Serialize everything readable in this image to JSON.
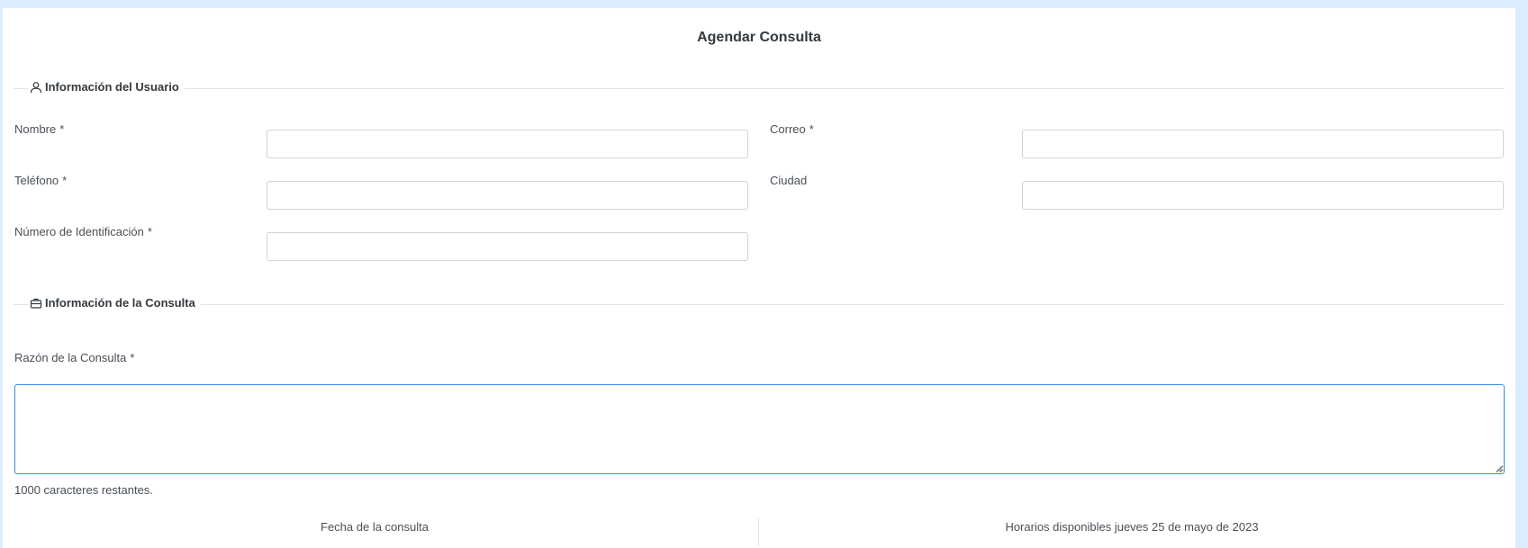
{
  "form": {
    "title": "Agendar Consulta",
    "required_mark": "*"
  },
  "user_section": {
    "legend": "Información del Usuario",
    "icon": "user-icon",
    "fields": {
      "nombre": {
        "label": "Nombre",
        "required": true,
        "value": ""
      },
      "correo": {
        "label": "Correo",
        "required": true,
        "value": ""
      },
      "telefono": {
        "label": "Teléfono",
        "required": true,
        "value": ""
      },
      "ciudad": {
        "label": "Ciudad",
        "required": false,
        "value": ""
      },
      "identificacion": {
        "label": "Número de Identificación",
        "required": true,
        "value": ""
      }
    }
  },
  "consult_section": {
    "legend": "Información de la Consulta",
    "icon": "briefcase-icon",
    "reason": {
      "label": "Razón de la Consulta",
      "required": true,
      "value": ""
    },
    "counter": "1000 caracteres restantes.",
    "date_label": "Fecha de la consulta",
    "schedule_label": "Horarios disponibles jueves 25 de mayo de 2023"
  },
  "colors": {
    "page_bg": "#dbeeff",
    "focus_border": "#2e8ee6",
    "input_border": "#ced4da"
  }
}
